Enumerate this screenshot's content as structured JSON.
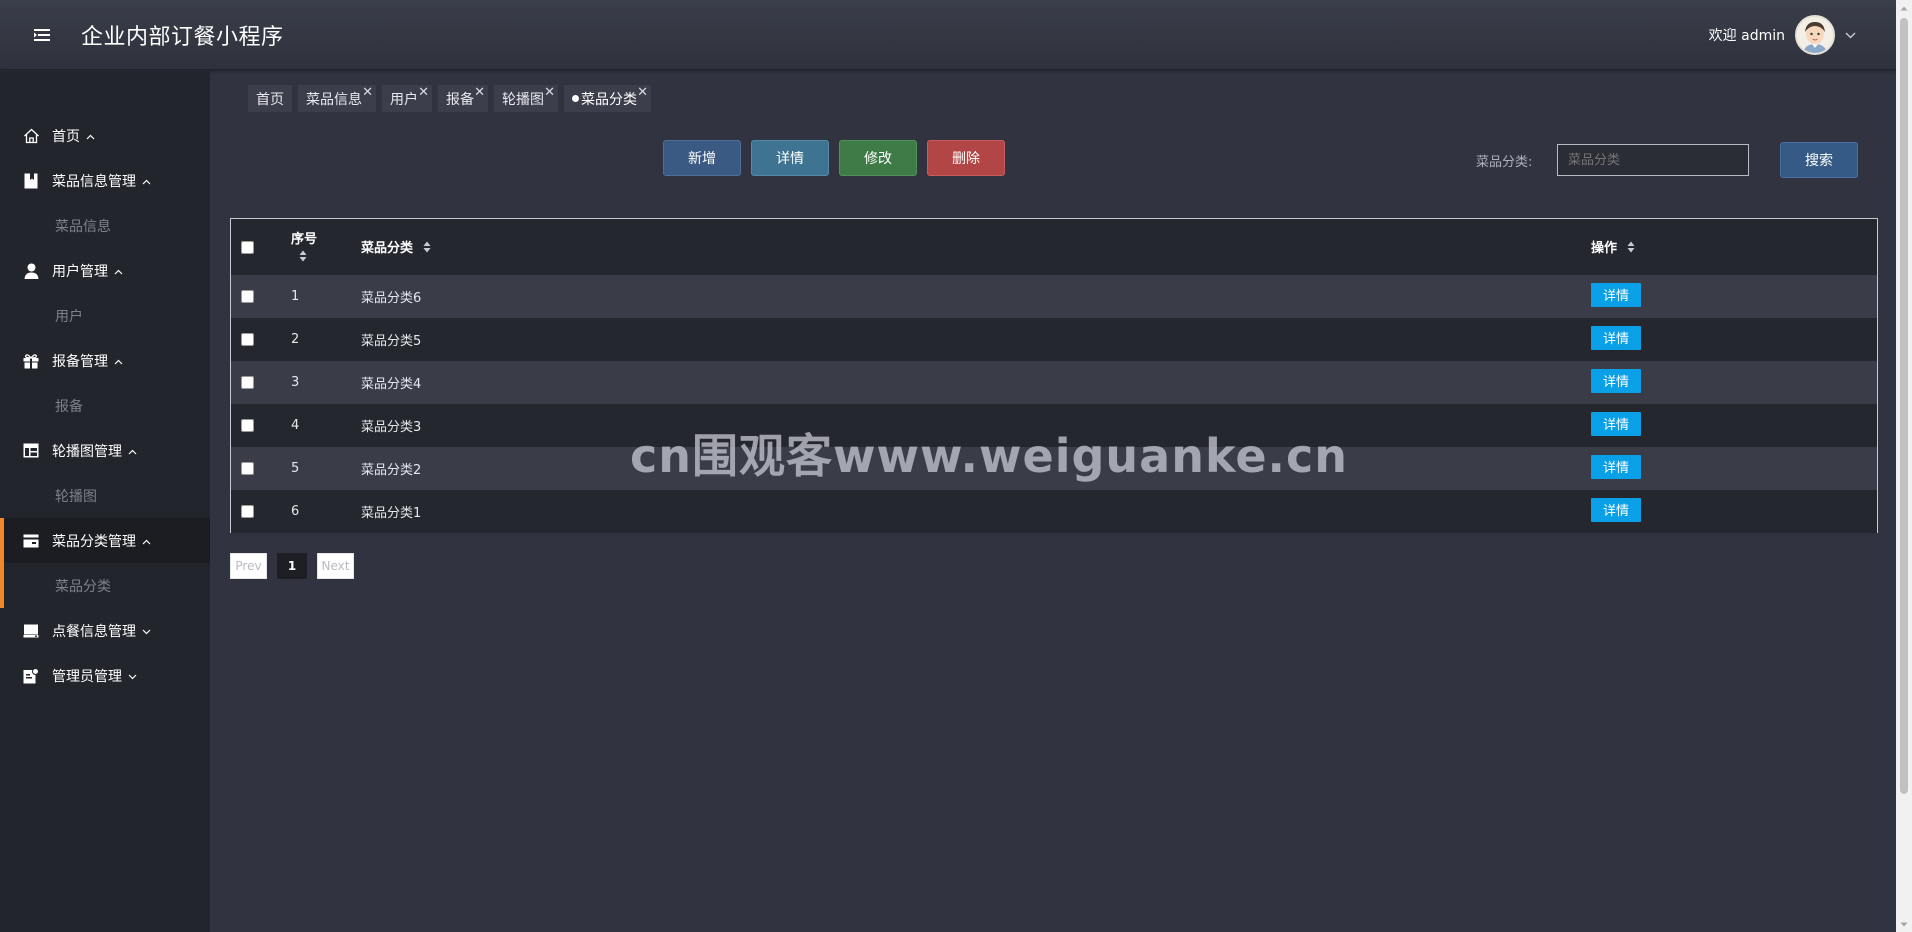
{
  "header": {
    "title": "企业内部订餐小程序",
    "welcome": "欢迎 admin"
  },
  "sidebar": {
    "groups": [
      {
        "label": "首页",
        "icon": "home-icon",
        "children": []
      },
      {
        "label": "菜品信息管理",
        "icon": "bookmark-icon",
        "children": [
          "菜品信息"
        ]
      },
      {
        "label": "用户管理",
        "icon": "user-icon",
        "children": [
          "用户"
        ]
      },
      {
        "label": "报备管理",
        "icon": "gift-icon",
        "children": [
          "报备"
        ]
      },
      {
        "label": "轮播图管理",
        "icon": "table-icon",
        "children": [
          "轮播图"
        ]
      },
      {
        "label": "菜品分类管理",
        "icon": "wallet-icon",
        "children": [
          "菜品分类"
        ],
        "active": true
      },
      {
        "label": "点餐信息管理",
        "icon": "drive-icon",
        "children": []
      },
      {
        "label": "管理员管理",
        "icon": "admin-icon",
        "children": []
      }
    ]
  },
  "tabs": [
    {
      "label": "首页"
    },
    {
      "label": "菜品信息"
    },
    {
      "label": "用户"
    },
    {
      "label": "报备"
    },
    {
      "label": "轮播图"
    },
    {
      "label": "菜品分类"
    }
  ],
  "toolbar": {
    "add": "新增",
    "detail": "详情",
    "edit": "修改",
    "delete": "删除",
    "search_label": "菜品分类:",
    "search_placeholder": "菜品分类",
    "search_button": "搜索"
  },
  "table": {
    "headers": {
      "index": "序号",
      "category": "菜品分类",
      "action": "操作"
    },
    "row_button": "详情",
    "rows": [
      {
        "index": "1",
        "category": "菜品分类6"
      },
      {
        "index": "2",
        "category": "菜品分类5"
      },
      {
        "index": "3",
        "category": "菜品分类4"
      },
      {
        "index": "4",
        "category": "菜品分类3"
      },
      {
        "index": "5",
        "category": "菜品分类2"
      },
      {
        "index": "6",
        "category": "菜品分类1"
      }
    ]
  },
  "pagination": {
    "prev": "Prev",
    "current": "1",
    "next": "Next"
  },
  "watermark": "cn围观客www.weiguanke.cn",
  "colors": {
    "accent": "#f0882a",
    "row_button": "#0aa0e8",
    "add": "#3a5a83",
    "detail": "#3e7391",
    "edit": "#3f7b47",
    "delete": "#b24545"
  }
}
